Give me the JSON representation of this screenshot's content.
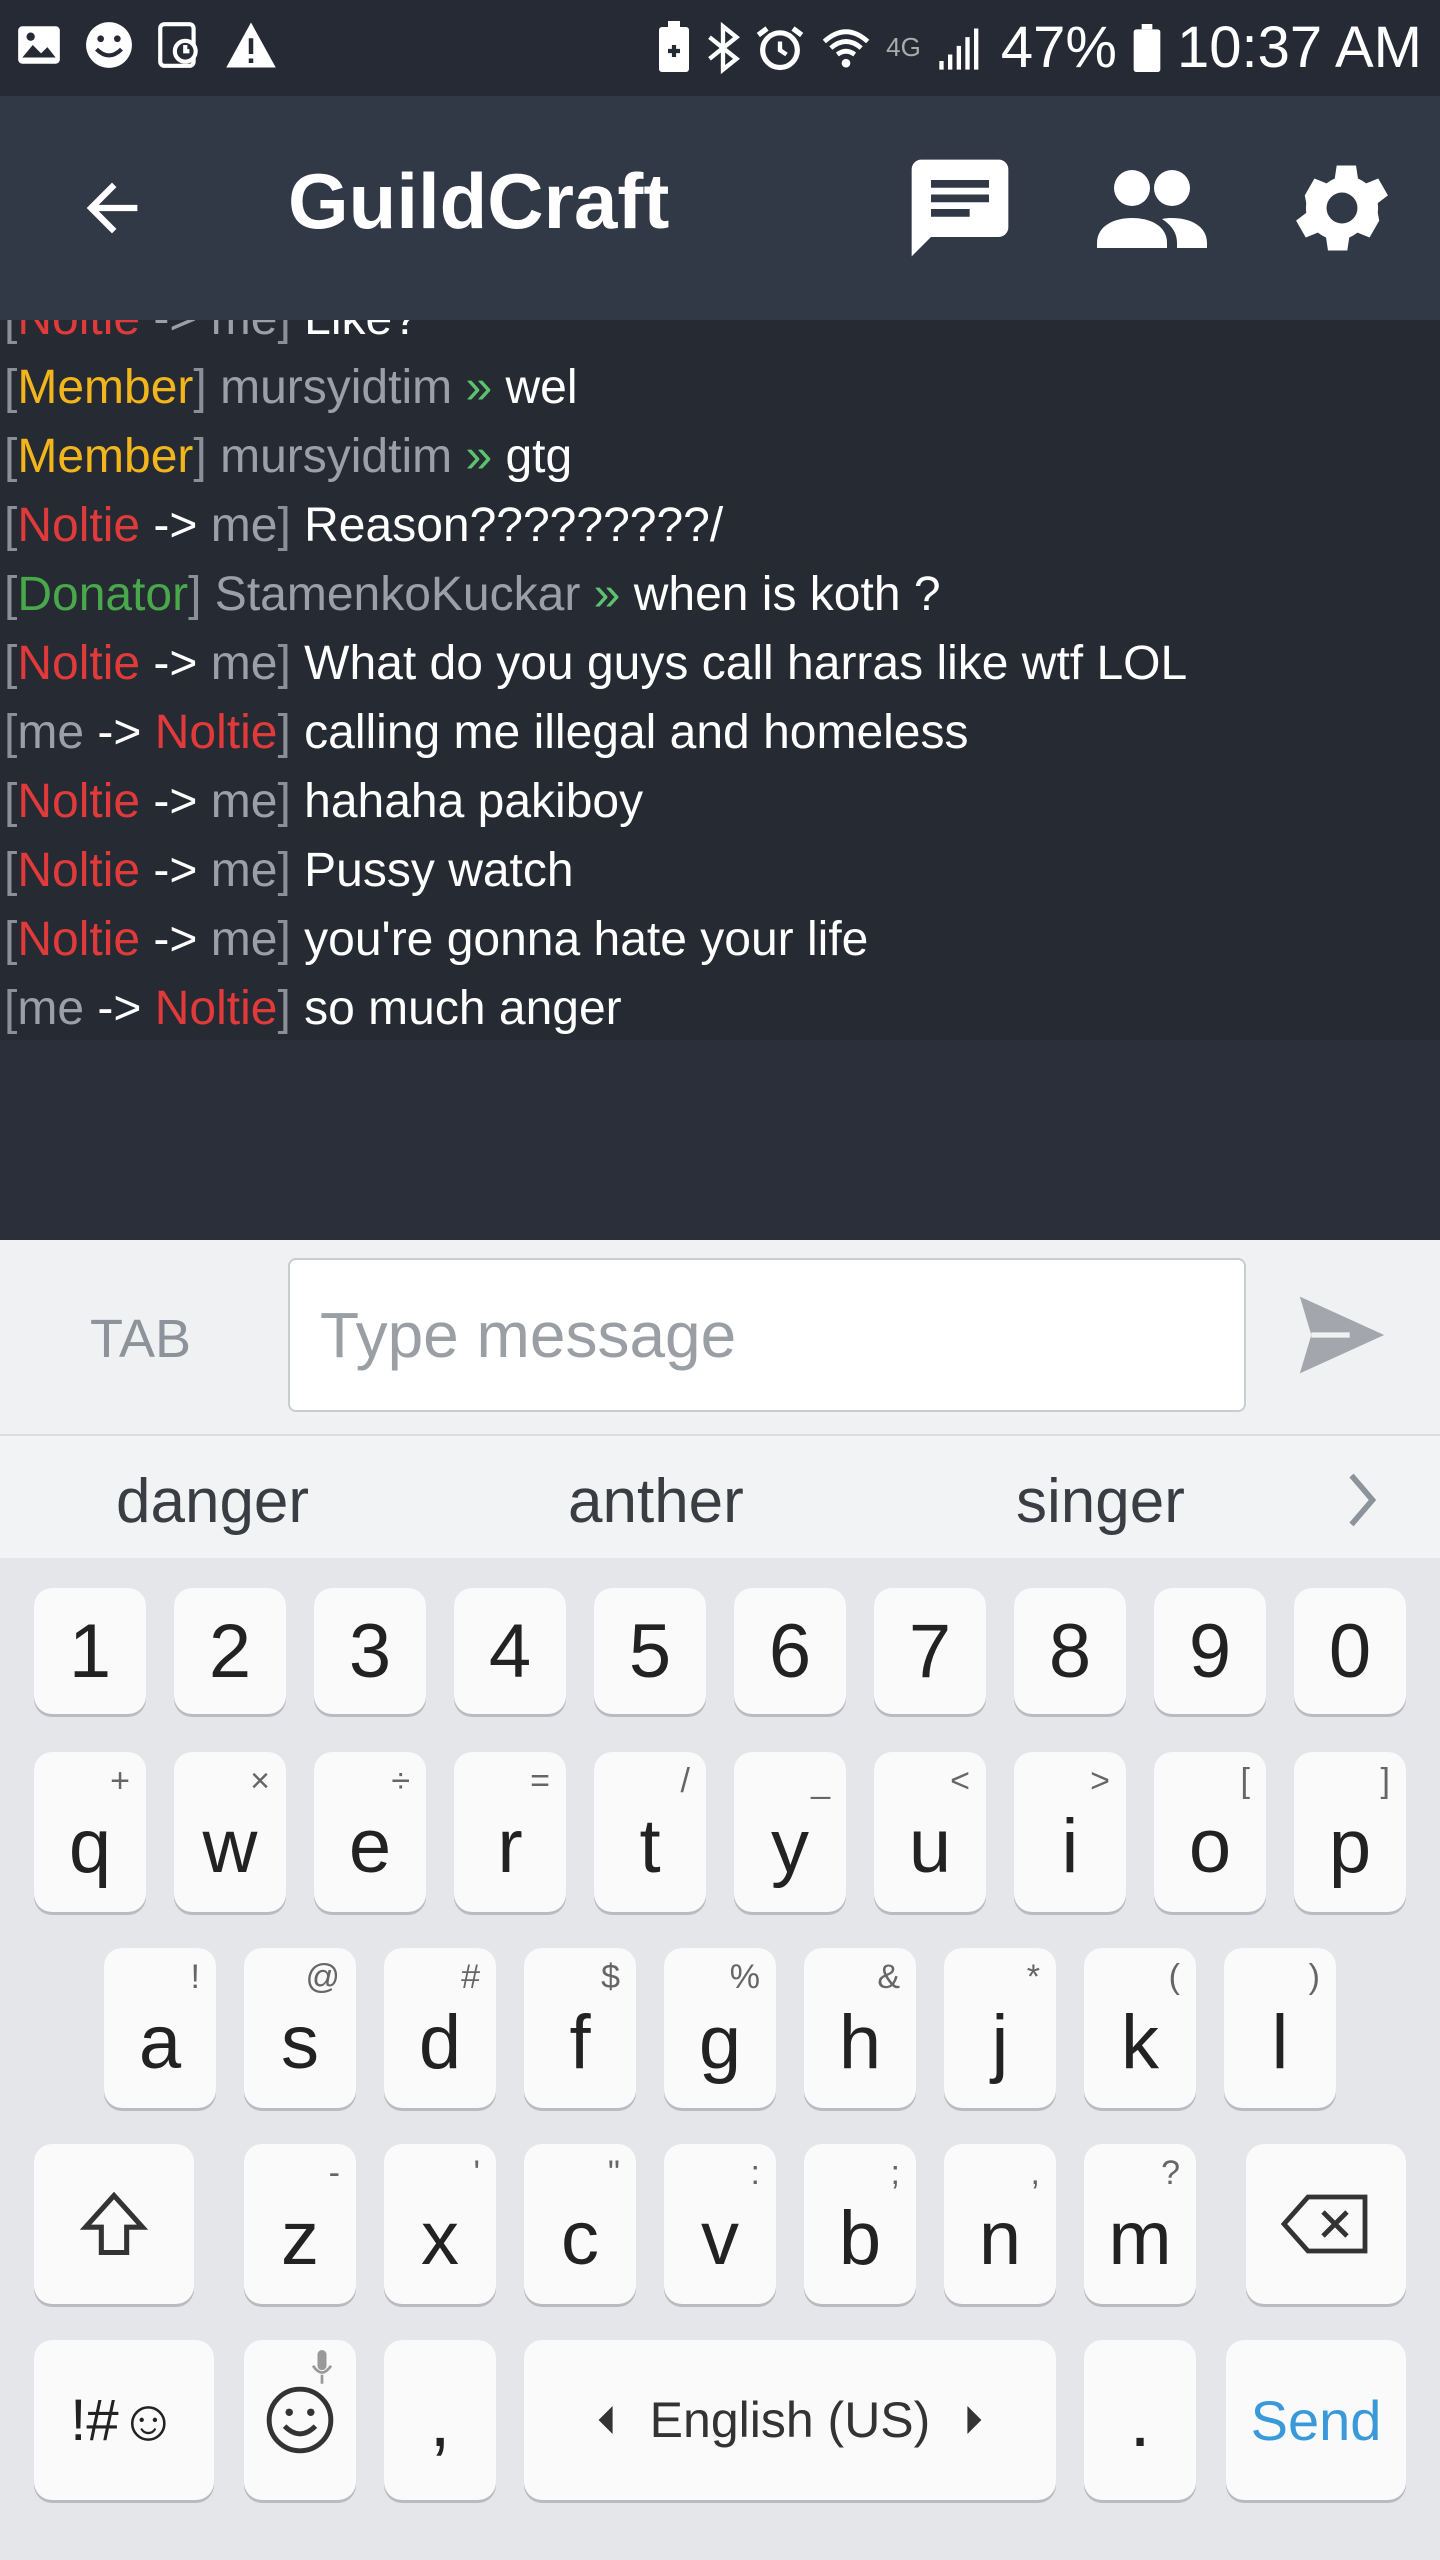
{
  "status_bar": {
    "left_icons": [
      "image-icon",
      "emoji-icon",
      "screenshot-icon",
      "warning-icon"
    ],
    "battery_percent": "47%",
    "time": "10:37 AM",
    "network": "4G"
  },
  "header": {
    "title": "GuildCraft"
  },
  "chat": {
    "partial_first_line": {
      "from": "Noltie",
      "arrow": "->",
      "to": "me",
      "text": "Like?"
    },
    "lines": [
      {
        "type": "rank",
        "rank": "Member",
        "user": "mursyidtim",
        "text": "wel"
      },
      {
        "type": "rank",
        "rank": "Member",
        "user": "mursyidtim",
        "text": "gtg"
      },
      {
        "type": "pm_in",
        "from": "Noltie",
        "arrow": "->",
        "to": "me",
        "text": "Reason?????????/"
      },
      {
        "type": "rank",
        "rank": "Donator",
        "user": "StamenkoKuckar",
        "text": "when is koth ?"
      },
      {
        "type": "pm_in",
        "from": "Noltie",
        "arrow": "->",
        "to": "me",
        "text": "What do you guys call harras like wtf LOL"
      },
      {
        "type": "pm_out",
        "from": "me",
        "arrow": "->",
        "to": "Noltie",
        "text": "calling me illegal and homeless"
      },
      {
        "type": "pm_in",
        "from": "Noltie",
        "arrow": "->",
        "to": "me",
        "text": "hahaha pakiboy"
      },
      {
        "type": "pm_in",
        "from": "Noltie",
        "arrow": "->",
        "to": "me",
        "text": "Pussy watch"
      },
      {
        "type": "pm_in",
        "from": "Noltie",
        "arrow": "->",
        "to": "me",
        "text": "you're gonna hate your life"
      },
      {
        "type": "pm_out",
        "from": "me",
        "arrow": "->",
        "to": "Noltie",
        "text": "so much anger"
      }
    ],
    "separator": "»"
  },
  "input": {
    "tab_label": "TAB",
    "placeholder": "Type message"
  },
  "suggestions": [
    "danger",
    "anther",
    "singer"
  ],
  "keyboard": {
    "numbers": [
      "1",
      "2",
      "3",
      "4",
      "5",
      "6",
      "7",
      "8",
      "9",
      "0"
    ],
    "row1": [
      "q",
      "w",
      "e",
      "r",
      "t",
      "y",
      "u",
      "i",
      "o",
      "p"
    ],
    "row1_secondary": [
      "+",
      "×",
      "÷",
      "=",
      "/",
      "_",
      "<",
      ">",
      "[",
      "]"
    ],
    "row2": [
      "a",
      "s",
      "d",
      "f",
      "g",
      "h",
      "j",
      "k",
      "l"
    ],
    "row2_secondary": [
      "!",
      "@",
      "#",
      "$",
      "%",
      "&",
      "*",
      "(",
      ")"
    ],
    "row3": [
      "z",
      "x",
      "c",
      "v",
      "b",
      "n",
      "m"
    ],
    "row3_secondary": [
      "-",
      "'",
      "\"",
      ":",
      ";",
      ",",
      "?"
    ],
    "symbols_label": "!#☺",
    "comma": ",",
    "space_label": "English (US)",
    "period": ".",
    "send_label": "Send"
  },
  "colors": {
    "red": "#e03a3a",
    "yellow": "#f2b51b",
    "green": "#48a84a",
    "send_blue": "#3a9ad9"
  }
}
